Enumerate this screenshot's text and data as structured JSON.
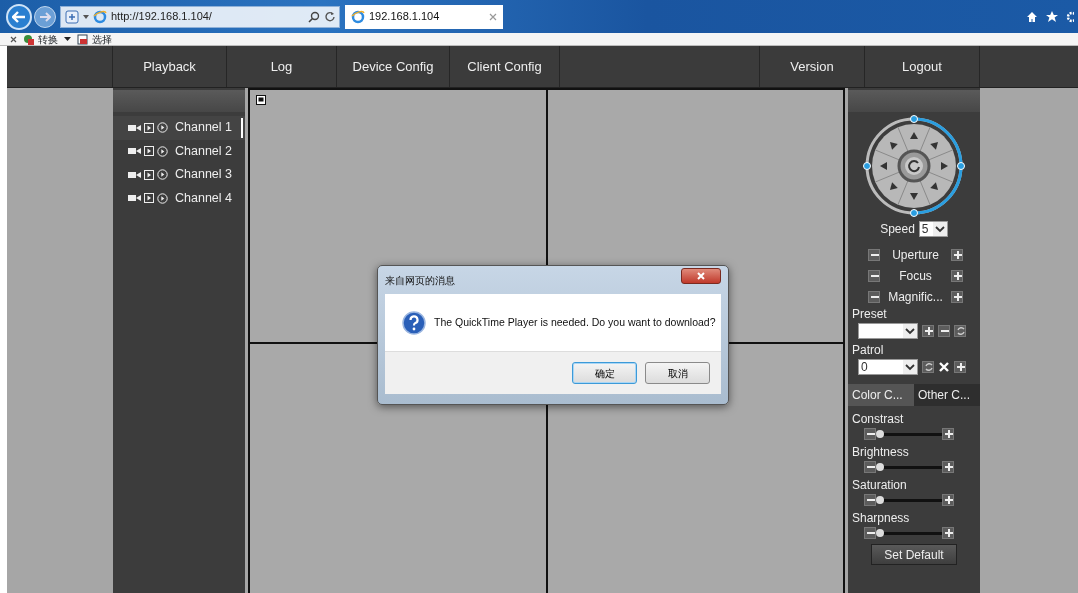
{
  "browser": {
    "address": "http://192.168.1.104/",
    "tab_title": "192.168.1.104",
    "toolbar": [
      {
        "label": "转换"
      },
      {
        "label": "选择"
      }
    ]
  },
  "nav": {
    "left": [
      {
        "label": "Playback"
      },
      {
        "label": "Log"
      },
      {
        "label": "Device Config"
      },
      {
        "label": "Client Config"
      }
    ],
    "right": [
      {
        "label": "Version"
      },
      {
        "label": "Logout"
      }
    ]
  },
  "channels": [
    {
      "label": "Channel 1",
      "selected": true
    },
    {
      "label": "Channel 2",
      "selected": false
    },
    {
      "label": "Channel 3",
      "selected": false
    },
    {
      "label": "Channel 4",
      "selected": false
    }
  ],
  "ptz": {
    "speed_label": "Speed",
    "speed": "5",
    "adjust": [
      {
        "label": "Uperture"
      },
      {
        "label": "Focus"
      },
      {
        "label": "Magnific..."
      }
    ],
    "preset": {
      "label": "Preset"
    },
    "patrol": {
      "label": "Patrol",
      "value": "0"
    },
    "tabs": [
      {
        "label": "Color C...",
        "selected": true
      },
      {
        "label": "Other C...",
        "selected": false
      }
    ],
    "sliders": [
      {
        "label": "Constrast",
        "level": 0.06
      },
      {
        "label": "Brightness",
        "level": 0.06
      },
      {
        "label": "Saturation",
        "level": 0.06
      },
      {
        "label": "Sharpness",
        "level": 0.06
      }
    ],
    "reset_button": "Set Default"
  },
  "dialog": {
    "title": "来自网页的消息",
    "message": "The QuickTime Player is needed. Do you want to download?",
    "buttons": [
      {
        "label": "确定",
        "default": true
      },
      {
        "label": "取消",
        "default": false
      }
    ]
  }
}
